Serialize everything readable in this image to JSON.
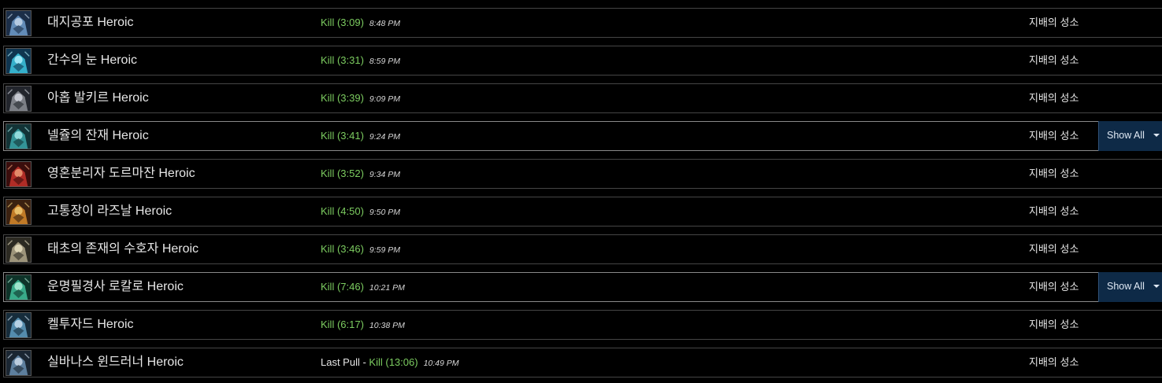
{
  "fights": [
    {
      "boss": "대지공포 Heroic",
      "prefix": "",
      "result": "Kill (3:09)",
      "time": "8:48 PM",
      "zone": "지배의 성소",
      "show_all": "",
      "icon": "armored-boss-icon",
      "colors": [
        "#6f9ccc",
        "#1b2e48",
        "#c9d9ec"
      ]
    },
    {
      "boss": "간수의 눈 Heroic",
      "prefix": "",
      "result": "Kill (3:31)",
      "time": "8:59 PM",
      "zone": "지배의 성소",
      "show_all": "",
      "icon": "eye-boss-icon",
      "colors": [
        "#3cc6e0",
        "#0f3550",
        "#b6f3ff"
      ]
    },
    {
      "boss": "아홉 발키르 Heroic",
      "prefix": "",
      "result": "Kill (3:39)",
      "time": "9:09 PM",
      "zone": "지배의 성소",
      "show_all": "",
      "icon": "valkyr-boss-icon",
      "colors": [
        "#8c8f96",
        "#22252c",
        "#d7dbe2"
      ]
    },
    {
      "boss": "넬쥴의 잔재 Heroic",
      "prefix": "",
      "result": "Kill (3:41)",
      "time": "9:24 PM",
      "zone": "지배의 성소",
      "show_all": "Show All",
      "icon": "lich-remnant-boss-icon",
      "colors": [
        "#3aa6a8",
        "#123336",
        "#a9ecec"
      ]
    },
    {
      "boss": "영혼분리자 도르마잔 Heroic",
      "prefix": "",
      "result": "Kill (3:52)",
      "time": "9:34 PM",
      "zone": "지배의 성소",
      "show_all": "",
      "icon": "soulrender-boss-icon",
      "colors": [
        "#c5322c",
        "#3a0d0c",
        "#f0a37a"
      ]
    },
    {
      "boss": "고통장이 라즈날 Heroic",
      "prefix": "",
      "result": "Kill (4:50)",
      "time": "9:50 PM",
      "zone": "지배의 성소",
      "show_all": "",
      "icon": "painsmith-boss-icon",
      "colors": [
        "#d98a2b",
        "#3b2110",
        "#f3d07a"
      ]
    },
    {
      "boss": "태초의 존재의 수호자 Heroic",
      "prefix": "",
      "result": "Kill (3:46)",
      "time": "9:59 PM",
      "zone": "지배의 성소",
      "show_all": "",
      "icon": "guardian-boss-icon",
      "colors": [
        "#b1a78a",
        "#2c2a22",
        "#ece3c4"
      ]
    },
    {
      "boss": "운명필경사 로칼로 Heroic",
      "prefix": "",
      "result": "Kill (7:46)",
      "time": "10:21 PM",
      "zone": "지배의 성소",
      "show_all": "Show All",
      "icon": "fatescribe-boss-icon",
      "colors": [
        "#3fbf9a",
        "#0e3329",
        "#b7f2dc"
      ]
    },
    {
      "boss": "켈투자드 Heroic",
      "prefix": "",
      "result": "Kill (6:17)",
      "time": "10:38 PM",
      "zone": "지배의 성소",
      "show_all": "",
      "icon": "kelthuzad-boss-icon",
      "colors": [
        "#5f9ec2",
        "#162c3b",
        "#cfe3f2"
      ]
    },
    {
      "boss": "실바나스 윈드러너 Heroic",
      "prefix": "Last Pull - ",
      "result": "Kill (13:06)",
      "time": "10:49 PM",
      "zone": "지배의 성소",
      "show_all": "",
      "icon": "sylvanas-boss-icon",
      "colors": [
        "#6a8fb2",
        "#1a2632",
        "#d2e0ee"
      ]
    }
  ]
}
